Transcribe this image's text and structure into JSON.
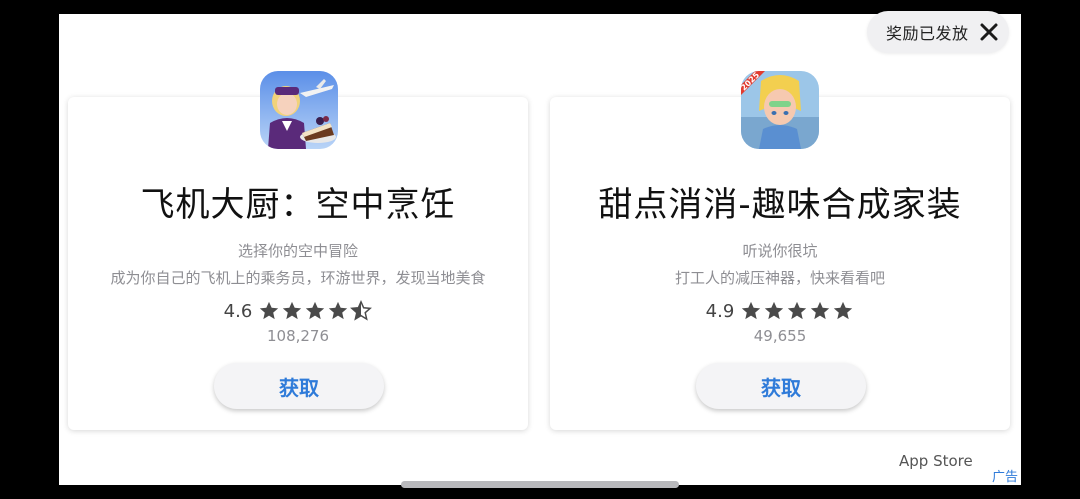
{
  "header": {
    "status_text": "奖励已发放",
    "close_icon": "close-icon"
  },
  "apps": [
    {
      "title": "飞机大厨：空中烹饪",
      "subtitle_line1": "选择你的空中冒险",
      "subtitle_line2": "成为你自己的飞机上的乘务员，环游世界，发现当地美食",
      "rating": "4.6",
      "rating_count": "108,276",
      "stars": 4.5,
      "get_label": "获取",
      "icon": "airline-chef-app-icon"
    },
    {
      "title": "甜点消消-趣味合成家装",
      "subtitle_line1": "听说你很坑",
      "subtitle_line2": "打工人的减压神器，快来看看吧",
      "rating": "4.9",
      "rating_count": "49,655",
      "stars": 5,
      "get_label": "获取",
      "icon": "dessert-match-app-icon",
      "icon_badge": "2025"
    }
  ],
  "footer": {
    "store_label": "App Store",
    "ad_label": "广告"
  },
  "colors": {
    "accent": "#2f7bd9",
    "star": "#4a4a4a"
  }
}
